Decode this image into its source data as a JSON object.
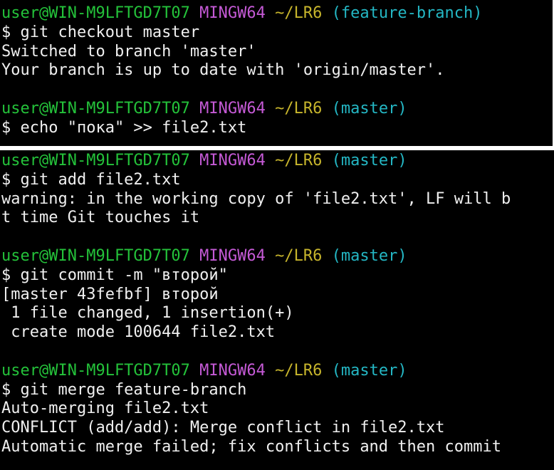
{
  "colors": {
    "background": "#000000",
    "text": "#f0f0f0",
    "user_host": "#24c23a",
    "mingw": "#c55ad6",
    "path": "#c7b52c",
    "branch": "#24b7c4"
  },
  "top_panel": {
    "prompt1": {
      "user": "user@WIN-M9LFTGD7T07",
      "env": "MINGW64",
      "path": "~/LR6",
      "branch": "(feature-branch)"
    },
    "cmd1": "$ git checkout master",
    "out1": "Switched to branch 'master'",
    "out2": "Your branch is up to date with 'origin/master'.",
    "prompt2": {
      "user": "user@WIN-M9LFTGD7T07",
      "env": "MINGW64",
      "path": "~/LR6",
      "branch": "(master)"
    },
    "cmd2": "$ echo \"пока\" >> file2.txt"
  },
  "bottom_panel": {
    "prompt1": {
      "user": "user@WIN-M9LFTGD7T07",
      "env": "MINGW64",
      "path": "~/LR6",
      "branch": "(master)"
    },
    "cmd1": "$ git add file2.txt",
    "out1": "warning: in the working copy of 'file2.txt', LF will b",
    "out2": "t time Git touches it",
    "prompt2": {
      "user": "user@WIN-M9LFTGD7T07",
      "env": "MINGW64",
      "path": "~/LR6",
      "branch": "(master)"
    },
    "cmd2": "$ git commit -m \"второй\"",
    "out3": "[master 43fefbf] второй",
    "out4": " 1 file changed, 1 insertion(+)",
    "out5": " create mode 100644 file2.txt",
    "prompt3": {
      "user": "user@WIN-M9LFTGD7T07",
      "env": "MINGW64",
      "path": "~/LR6",
      "branch": "(master)"
    },
    "cmd3": "$ git merge feature-branch",
    "out6": "Auto-merging file2.txt",
    "out7": "CONFLICT (add/add): Merge conflict in file2.txt",
    "out8": "Automatic merge failed; fix conflicts and then commit"
  }
}
